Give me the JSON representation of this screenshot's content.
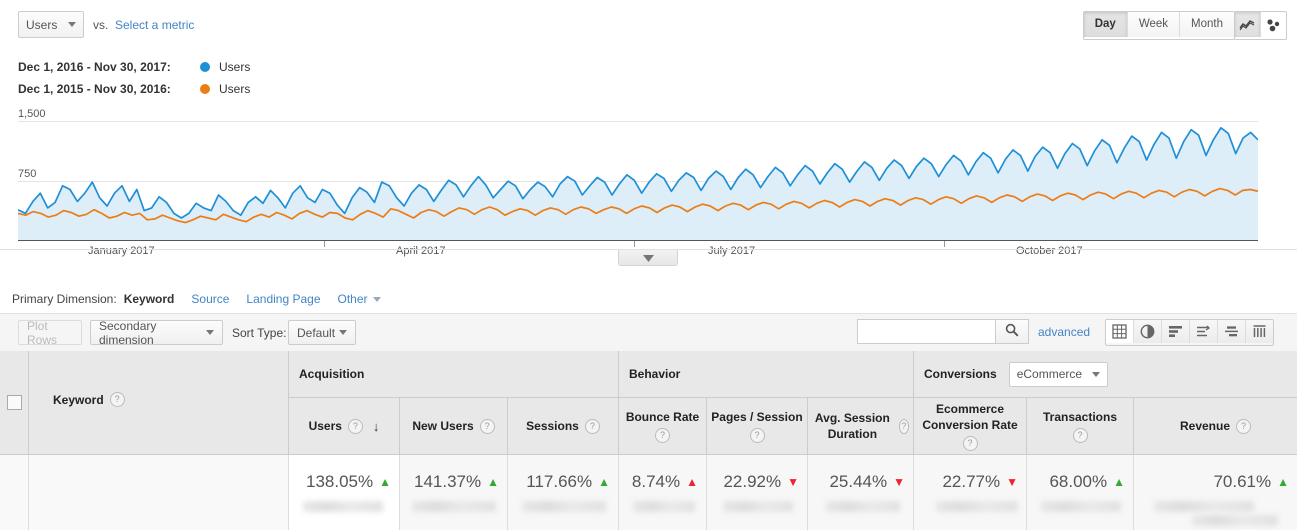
{
  "metric_bar": {
    "primary_metric": "Users",
    "vs_label": "vs.",
    "select_metric_link": "Select a metric",
    "granularity": [
      {
        "label": "Day",
        "selected": true
      },
      {
        "label": "Week",
        "selected": false
      },
      {
        "label": "Month",
        "selected": false
      }
    ],
    "chart_types": [
      {
        "name": "line-chart-icon",
        "selected": true
      },
      {
        "name": "motion-chart-icon",
        "selected": false
      }
    ]
  },
  "legend": [
    {
      "range": "Dec 1, 2016 - Nov 30, 2017:",
      "metric": "Users",
      "color": "#1f8fd6"
    },
    {
      "range": "Dec 1, 2015 - Nov 30, 2016:",
      "metric": "Users",
      "color": "#ec7d16"
    }
  ],
  "chart_data": {
    "type": "line",
    "title": "",
    "xlabel": "",
    "ylabel": "Users",
    "ylim": [
      0,
      1500
    ],
    "yticks": [
      1500,
      750
    ],
    "ytick_labels": [
      "1,500",
      "750"
    ],
    "grid": true,
    "legend_position": "top-left",
    "xtick_labels": [
      "January 2017",
      "April 2017",
      "July 2017",
      "October 2017"
    ],
    "xtick_positions_pct": [
      8.5,
      33.5,
      58.5,
      83.5
    ],
    "series": [
      {
        "name": "Users",
        "range": "Dec 1, 2016 - Nov 30, 2017",
        "color": "#1f8fd6",
        "fill": "#ddeef8",
        "values": [
          340,
          300,
          430,
          520,
          360,
          420,
          600,
          560,
          430,
          520,
          640,
          470,
          380,
          520,
          600,
          430,
          560,
          330,
          360,
          480,
          420,
          300,
          250,
          300,
          410,
          360,
          330,
          500,
          430,
          330,
          280,
          420,
          480,
          410,
          550,
          470,
          360,
          520,
          600,
          470,
          420,
          560,
          520,
          390,
          300,
          470,
          580,
          530,
          420,
          640,
          600,
          470,
          380,
          520,
          610,
          560,
          430,
          550,
          660,
          610,
          480,
          600,
          700,
          610,
          470,
          560,
          650,
          600,
          460,
          560,
          640,
          590,
          480,
          620,
          700,
          650,
          500,
          600,
          690,
          640,
          500,
          620,
          720,
          660,
          520,
          640,
          730,
          680,
          540,
          660,
          740,
          690,
          550,
          680,
          760,
          700,
          560,
          690,
          780,
          720,
          580,
          700,
          800,
          740,
          600,
          720,
          820,
          760,
          620,
          740,
          840,
          780,
          640,
          760,
          860,
          800,
          660,
          790,
          880,
          820,
          680,
          810,
          900,
          840,
          700,
          830,
          930,
          870,
          720,
          860,
          960,
          900,
          740,
          890,
          990,
          930,
          760,
          920,
          1020,
          960,
          790,
          950,
          1060,
          1000,
          820,
          980,
          1100,
          1040,
          850,
          1010,
          1140,
          1080,
          880,
          1050,
          1180,
          1120,
          900,
          1080,
          1210,
          1150,
          930,
          1100,
          1230,
          1170,
          950,
          1120,
          1180,
          1100
        ]
      },
      {
        "name": "Users",
        "range": "Dec 1, 2015 - Nov 30, 2016",
        "color": "#ec7d16",
        "fill": "none",
        "values": [
          300,
          280,
          320,
          300,
          260,
          280,
          330,
          310,
          270,
          290,
          340,
          300,
          250,
          270,
          310,
          280,
          300,
          230,
          240,
          280,
          250,
          220,
          200,
          230,
          270,
          250,
          230,
          290,
          260,
          230,
          210,
          260,
          290,
          260,
          310,
          280,
          240,
          300,
          330,
          290,
          260,
          310,
          300,
          250,
          230,
          290,
          330,
          300,
          260,
          350,
          330,
          290,
          250,
          310,
          340,
          320,
          270,
          320,
          360,
          340,
          290,
          340,
          370,
          340,
          280,
          320,
          350,
          330,
          280,
          330,
          360,
          340,
          290,
          340,
          370,
          350,
          300,
          340,
          370,
          350,
          300,
          350,
          380,
          360,
          310,
          360,
          390,
          370,
          320,
          370,
          400,
          380,
          330,
          380,
          410,
          390,
          340,
          390,
          420,
          400,
          350,
          400,
          430,
          410,
          360,
          410,
          440,
          420,
          370,
          420,
          450,
          430,
          380,
          430,
          460,
          440,
          390,
          440,
          470,
          450,
          400,
          450,
          480,
          460,
          410,
          460,
          490,
          470,
          420,
          470,
          500,
          480,
          430,
          480,
          510,
          490,
          440,
          490,
          520,
          500,
          450,
          500,
          530,
          510,
          460,
          510,
          540,
          520,
          470,
          520,
          550,
          530,
          480,
          530,
          560,
          540,
          490,
          540,
          570,
          550,
          500,
          550,
          560,
          540
        ]
      }
    ]
  },
  "collapse_control": {
    "name": "collapse-chart-toggle",
    "icon": "chevron-down-icon"
  },
  "primary_dimension": {
    "label": "Primary Dimension:",
    "current": "Keyword",
    "links": [
      "Source",
      "Landing Page"
    ],
    "other": "Other"
  },
  "toolbar": {
    "plot_rows": "Plot Rows",
    "secondary_dimension": "Secondary dimension",
    "sort_type_label": "Sort Type:",
    "sort_type_value": "Default",
    "search_value": "",
    "search_placeholder": "",
    "advanced": "advanced",
    "views": [
      {
        "name": "table-view-icon",
        "selected": true
      },
      {
        "name": "pie-chart-view-icon",
        "selected": false
      },
      {
        "name": "bar-chart-view-icon",
        "selected": false
      },
      {
        "name": "performance-view-icon",
        "selected": false
      },
      {
        "name": "comparison-view-icon",
        "selected": false
      },
      {
        "name": "pivot-view-icon",
        "selected": false
      }
    ]
  },
  "table": {
    "dimension_header": "Keyword",
    "groups": [
      {
        "label": "Acquisition"
      },
      {
        "label": "Behavior"
      },
      {
        "label": "Conversions",
        "select_value": "eCommerce"
      }
    ],
    "columns": [
      {
        "label": "Users",
        "sorted": true,
        "sort_dir": "↓"
      },
      {
        "label": "New Users"
      },
      {
        "label": "Sessions"
      },
      {
        "label": "Bounce Rate"
      },
      {
        "label": "Pages / Session"
      },
      {
        "label": "Avg. Session Duration"
      },
      {
        "label": "Ecommerce Conversion Rate"
      },
      {
        "label": "Transactions"
      },
      {
        "label": "Revenue"
      }
    ],
    "summary_row": [
      {
        "value": "138.05%",
        "dir": "up",
        "color": "green"
      },
      {
        "value": "141.37%",
        "dir": "up",
        "color": "green"
      },
      {
        "value": "117.66%",
        "dir": "up",
        "color": "green"
      },
      {
        "value": "8.74%",
        "dir": "up",
        "color": "red"
      },
      {
        "value": "22.92%",
        "dir": "down",
        "color": "red"
      },
      {
        "value": "25.44%",
        "dir": "down",
        "color": "red"
      },
      {
        "value": "22.77%",
        "dir": "down",
        "color": "red"
      },
      {
        "value": "68.00%",
        "dir": "up",
        "color": "green"
      },
      {
        "value": "70.61%",
        "dir": "up",
        "color": "green"
      }
    ]
  }
}
